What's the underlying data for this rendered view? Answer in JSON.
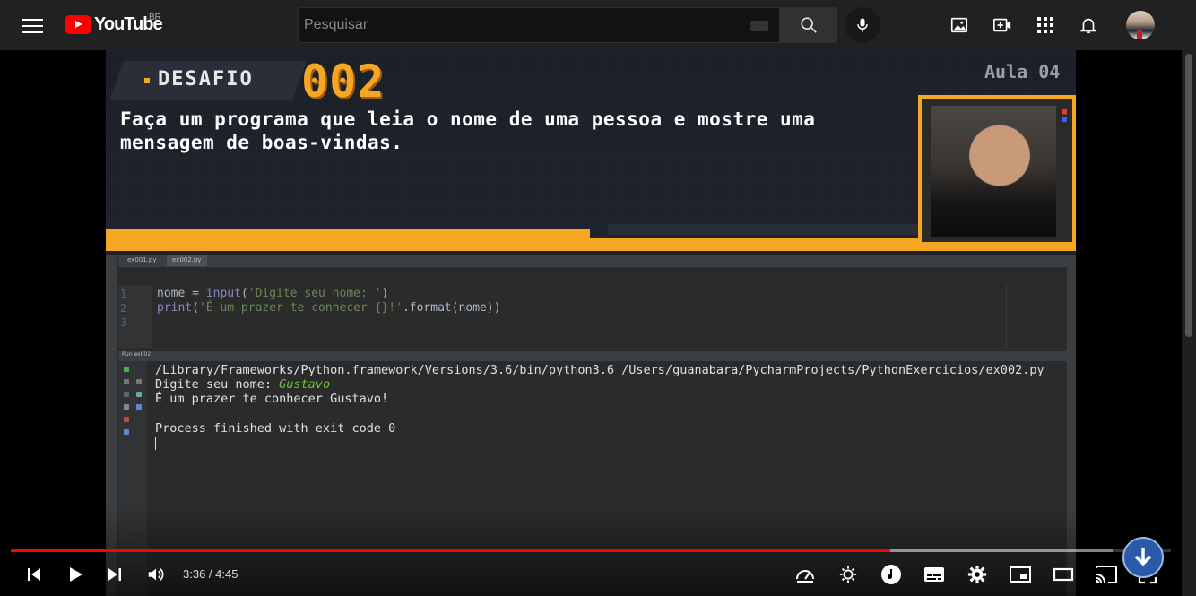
{
  "header": {
    "logo_text": "YouTube",
    "region": "BR",
    "search_placeholder": "Pesquisar"
  },
  "video": {
    "desafio_label": "DESAFIO",
    "desafio_number": "002",
    "lesson": "Aula 04",
    "challenge_text": "Faça um programa que leia o nome de uma pessoa e mostre uma mensagem de boas-vindas.",
    "ide": {
      "tabs": [
        "ex001.py",
        "ex002.py"
      ],
      "run_label": "Run",
      "run_config": "ex002",
      "line_numbers": [
        "1",
        "2",
        "3"
      ],
      "code": {
        "line1_var": "nome = ",
        "line1_fn": "input",
        "line1_open": "(",
        "line1_str": "'Digite seu nome: '",
        "line1_close": ")",
        "line2_fn": "print",
        "line2_open": "(",
        "line2_str": "'É um prazer te conhecer {}!'",
        "line2_rest": ".format(nome))"
      },
      "console": {
        "command": "/Library/Frameworks/Python.framework/Versions/3.6/bin/python3.6 /Users/guanabara/PycharmProjects/PythonExercicios/ex002.py",
        "prompt": "Digite seu nome: ",
        "input": "Gustavo",
        "greeting": "É um prazer te conhecer Gustavo!",
        "exit": "Process finished with exit code 0"
      }
    }
  },
  "player": {
    "current_time": "3:36",
    "duration": "4:45",
    "time_display": "3:36 / 4:45",
    "progress_fraction": 0.758,
    "buffer_fraction": 0.95
  },
  "colors": {
    "accent_red": "#ff0000",
    "banner_orange": "#f5a623"
  }
}
